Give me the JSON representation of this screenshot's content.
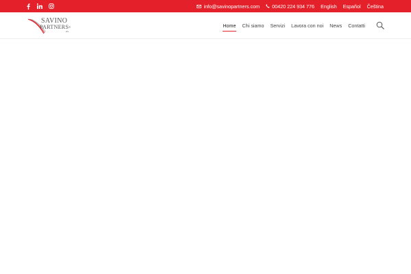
{
  "topbar": {
    "social": [
      {
        "icon": "facebook-icon"
      },
      {
        "icon": "linkedin-icon"
      },
      {
        "icon": "instagram-icon"
      }
    ],
    "email": "info@savinopartners.com",
    "phone": "00420 224 934 776",
    "languages": [
      "English",
      "Español",
      "Čeština"
    ]
  },
  "logo": {
    "line1": "SAVINO",
    "line2": "PARTNERS",
    "reg": "®",
    "suffix": "a.s."
  },
  "nav": {
    "items": [
      "Home",
      "Chi siamo",
      "Servizi",
      "Lavora con noi",
      "News",
      "Contatti"
    ],
    "active_index": 0
  },
  "colors": {
    "brand_red": "#e4202a",
    "nav_text": "#444444",
    "logo_text": "#555555"
  },
  "icons": {
    "email": "envelope-icon",
    "phone": "phone-icon",
    "search": "search-icon"
  }
}
